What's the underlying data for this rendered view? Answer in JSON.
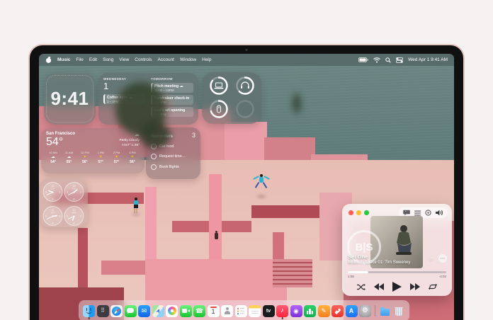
{
  "menu_bar": {
    "app_menus": [
      "Music",
      "File",
      "Edit",
      "Song",
      "View",
      "Controls",
      "Account",
      "Window",
      "Help"
    ],
    "status": {
      "icons": [
        "battery-icon",
        "wifi-icon",
        "search-icon",
        "control-center-icon"
      ],
      "date_time": "Wed Apr 1  9:41 AM"
    }
  },
  "widgets": {
    "clock": {
      "time": "9:41"
    },
    "calendar": {
      "today_label": "WEDNESDAY",
      "today_date": "1",
      "today_events": [
        {
          "title": "Coffee sync ☁",
          "time": "1 – 2PM"
        }
      ],
      "tomorrow_label": "TOMORROW",
      "tomorrow_events": [
        {
          "title": "Pitch meeting ☁",
          "time": "11AM – 12PM"
        },
        {
          "title": "Fundraiser check-in",
          "time": "3 – 6PM"
        },
        {
          "title": "Lou's art opening",
          "time": "7 – 8PM"
        }
      ]
    },
    "batteries": {
      "rings": [
        {
          "device": "laptop",
          "level": 85
        },
        {
          "device": "headphones",
          "level": 62
        },
        {
          "device": "mouse",
          "level": 70
        },
        {
          "device": "empty",
          "level": 0
        }
      ]
    },
    "weather": {
      "city": "San Francisco",
      "temp": "54°",
      "sky_icon": "☁",
      "condition": "Partly Cloudy",
      "high_low": "H:57° L:49°",
      "hourly": [
        {
          "hour": "10 AM",
          "icon": "☁",
          "sunny": false,
          "temp": "54°"
        },
        {
          "hour": "11 AM",
          "icon": "☁",
          "sunny": false,
          "temp": "55°"
        },
        {
          "hour": "12 PM",
          "icon": "☀",
          "sunny": true,
          "temp": "56°"
        },
        {
          "hour": "1 PM",
          "icon": "☀",
          "sunny": true,
          "temp": "57°"
        },
        {
          "hour": "2 PM",
          "icon": "☀",
          "sunny": true,
          "temp": "57°"
        },
        {
          "hour": "3 PM",
          "icon": "☀",
          "sunny": true,
          "temp": "56°"
        }
      ]
    },
    "reminders": {
      "title": "Reminders",
      "count": "3",
      "items": [
        "Cat food",
        "Request time…",
        "Book flights"
      ]
    },
    "world_clock": {
      "cities": [
        {
          "label": "CUP",
          "time": "9:41"
        },
        {
          "label": "TOK",
          "time": "1:41"
        },
        {
          "label": "SYD",
          "time": "2:41"
        },
        {
          "label": "PAR",
          "time": "6:41"
        }
      ]
    }
  },
  "music_player": {
    "top_icons": [
      "lyrics-icon",
      "queue-icon",
      "radio-icon",
      "volume-icon"
    ],
    "logo_text": "B|S",
    "track_title": "Set One",
    "track_subtitle": "Beats In Space 01: Tim Sweeney",
    "star_glyph": "☆",
    "more_glyph": "⋯",
    "elapsed": "1:08",
    "remaining": "-4:02",
    "progress_pct": 21
  },
  "dock": {
    "items": [
      {
        "name": "finder",
        "glyph": "",
        "running": true
      },
      {
        "name": "launchpad",
        "glyph": "⠿",
        "running": false
      },
      {
        "name": "safari",
        "glyph": "",
        "running": false
      },
      {
        "name": "messages",
        "glyph": "",
        "running": false
      },
      {
        "name": "mail",
        "glyph": "✉",
        "running": false
      },
      {
        "name": "maps",
        "glyph": "",
        "running": false
      },
      {
        "name": "photos",
        "glyph": "",
        "running": false
      },
      {
        "name": "facetime",
        "glyph": "",
        "running": false
      },
      {
        "name": "phone",
        "glyph": "☎",
        "running": false
      },
      {
        "name": "calendar",
        "glyph": "1",
        "running": false
      },
      {
        "name": "contacts",
        "glyph": "",
        "running": false
      },
      {
        "name": "reminders",
        "glyph": "",
        "running": false
      },
      {
        "name": "notes",
        "glyph": "",
        "running": false
      },
      {
        "name": "tv",
        "glyph": "tv",
        "running": false
      },
      {
        "name": "music",
        "glyph": "♪",
        "running": true
      },
      {
        "name": "podcasts",
        "glyph": "◉",
        "running": false
      },
      {
        "name": "numbers",
        "glyph": "",
        "running": false
      },
      {
        "name": "pages",
        "glyph": "✎",
        "running": false
      },
      {
        "name": "rocket",
        "glyph": "",
        "running": false
      },
      {
        "name": "appstore",
        "glyph": "A",
        "running": false
      },
      {
        "name": "settings",
        "glyph": "⚙",
        "running": false
      },
      {
        "name": "folder",
        "glyph": "",
        "running": false
      },
      {
        "name": "trash",
        "glyph": "",
        "running": false
      }
    ]
  },
  "accent_colors": {
    "wall_pink": "#e79ca3",
    "wall_red": "#b5525c",
    "sea_teal": "#5f7c7a",
    "traffic_red": "#ff5f57",
    "traffic_yellow": "#febc2e",
    "traffic_green": "#28c840"
  }
}
